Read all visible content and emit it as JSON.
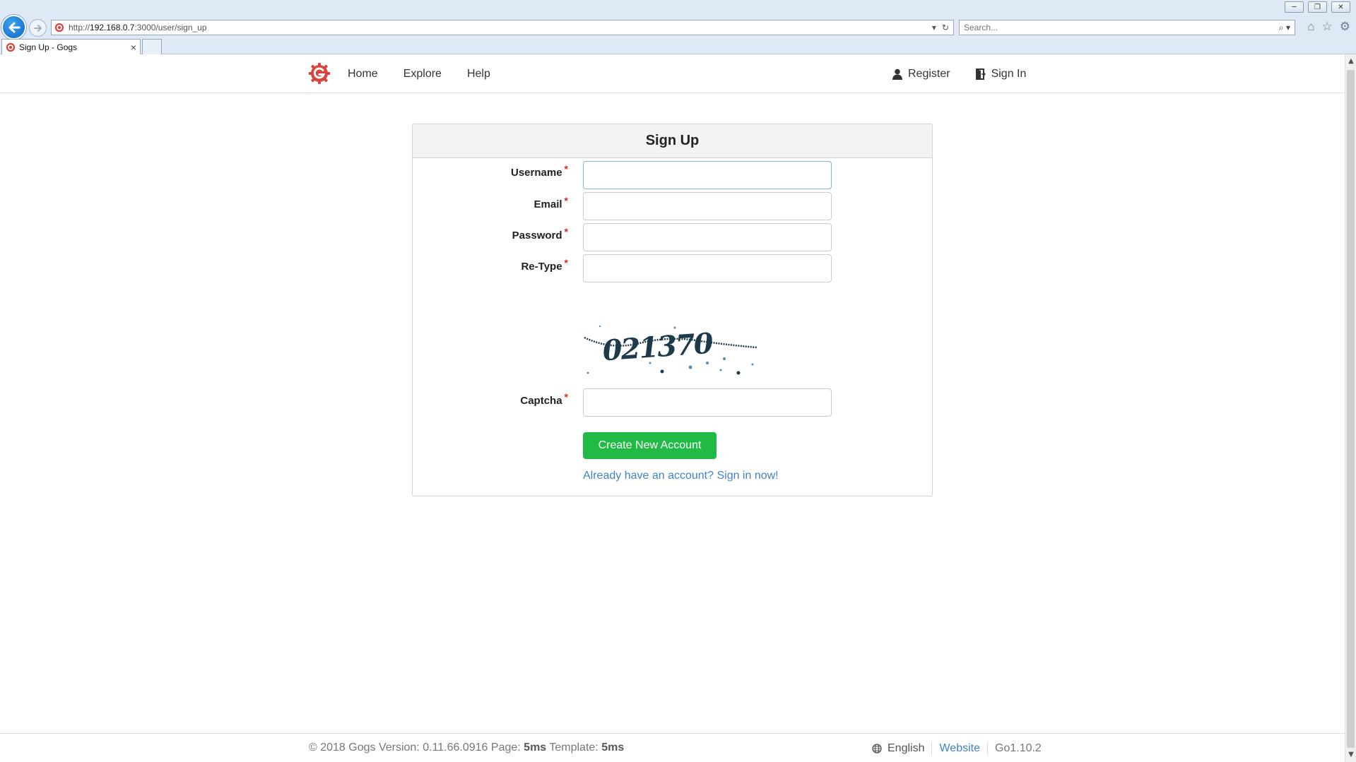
{
  "browser": {
    "url_prefix": "http://",
    "url_host": "192.168.0.7",
    "url_rest": ":3000/user/sign_up",
    "search_placeholder": "Search...",
    "tab_title": "Sign Up - Gogs",
    "tab_close": "×",
    "win_minimize": "─",
    "win_restore": "❐",
    "win_close": "✕"
  },
  "nav": {
    "home": "Home",
    "explore": "Explore",
    "help": "Help",
    "register": "Register",
    "sign_in": "Sign In"
  },
  "form": {
    "title": "Sign Up",
    "username_label": "Username",
    "email_label": "Email",
    "password_label": "Password",
    "retype_label": "Re-Type",
    "captcha_label": "Captcha",
    "required_mark": "*",
    "captcha_text": "021370",
    "submit_label": "Create New Account",
    "signin_link": "Already have an account? Sign in now!",
    "username_value": "",
    "email_value": "",
    "password_value": "",
    "retype_value": "",
    "captcha_value": ""
  },
  "footer": {
    "copyright": "© 2018 Gogs Version: 0.11.66.0916 Page:",
    "page_time": "5ms",
    "template_label": "Template:",
    "template_time": "5ms",
    "language": "English",
    "website": "Website",
    "go_version": "Go1.10.2"
  },
  "colors": {
    "accent_green": "#21ba45",
    "link_blue": "#4183c4",
    "required_red": "#db2828",
    "gogs_red": "#d9453d"
  }
}
